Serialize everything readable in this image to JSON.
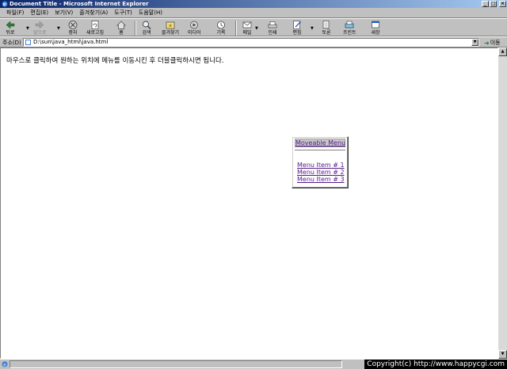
{
  "window": {
    "title": "Document Title - Microsoft Internet Explorer"
  },
  "menubar": [
    {
      "label": "파일(F)"
    },
    {
      "label": "편집(E)"
    },
    {
      "label": "보기(V)"
    },
    {
      "label": "즐겨찾기(A)"
    },
    {
      "label": "도구(T)"
    },
    {
      "label": "도움말(H)"
    }
  ],
  "toolbar": {
    "back": "뒤로",
    "forward": "앞으로",
    "stop": "중지",
    "refresh": "새로고침",
    "home": "홈",
    "search": "검색",
    "favorites": "즐겨찾기",
    "media": "미디어",
    "history": "기록",
    "mail": "메일",
    "print": "인쇄",
    "edit": "편집",
    "discuss": "토론",
    "print2": "프린트",
    "messenger": "새창"
  },
  "address": {
    "label": "주소(D)",
    "url": "D:\\sun\\java_html\\java.html",
    "go": "이동"
  },
  "content": {
    "instruction": "마우스로 클릭하여 원하는 위치에 메뉴를 이동시킨 후 더블클릭하시면 됩니다.",
    "menu": {
      "title": "Moveable Menu",
      "items": [
        "Menu Item # 1",
        "Menu Item # 2",
        "Menu Item # 3"
      ]
    }
  },
  "status": {
    "copyright": "Copyright(c) http://www.happycgi.com"
  },
  "colors": {
    "titlebar": "#0a246a",
    "visited_link": "#551a8b",
    "chrome": "#c0c0c0"
  }
}
